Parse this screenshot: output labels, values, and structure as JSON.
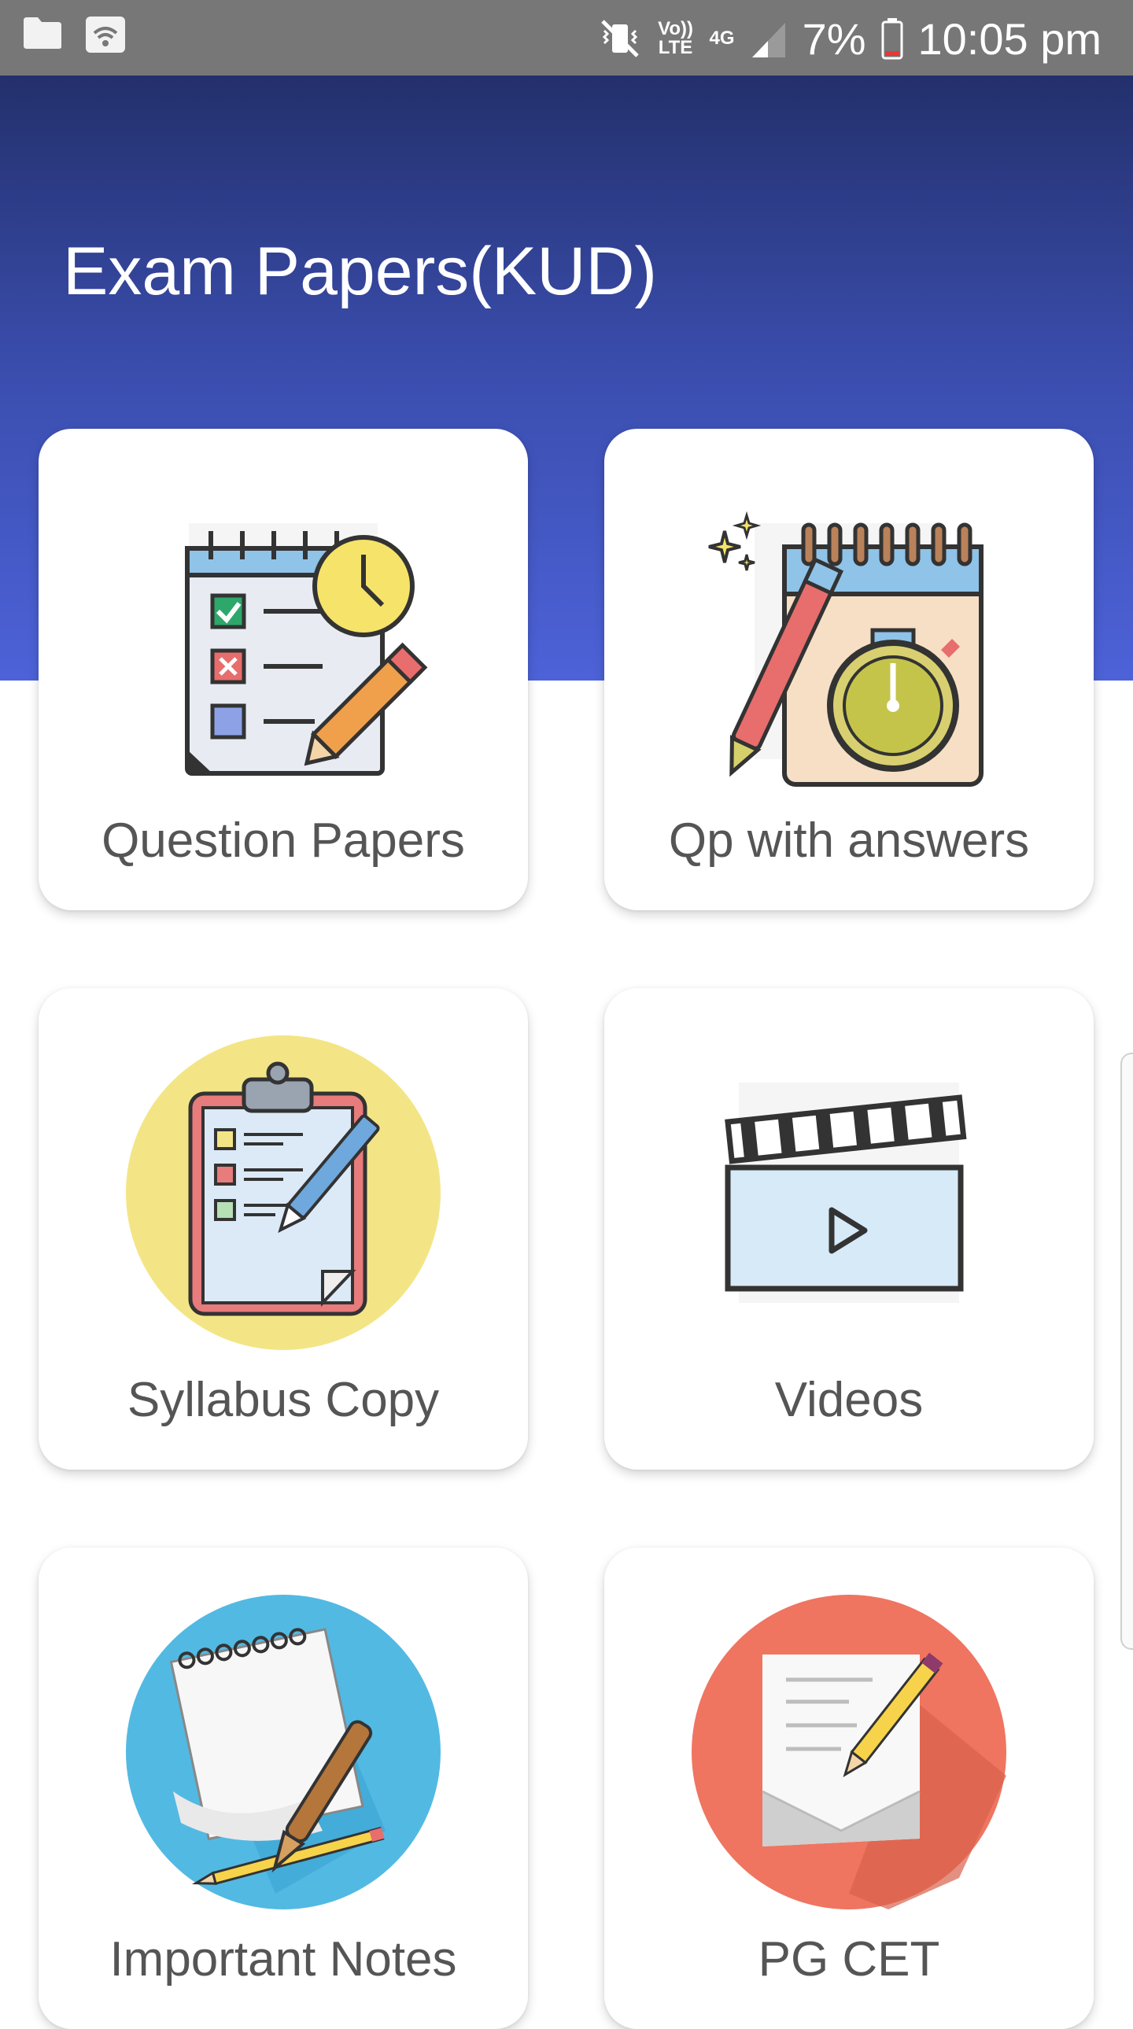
{
  "status_bar": {
    "volte_label": "Vo)) LTE",
    "network_label": "4G",
    "battery_percent": "7%",
    "time": "10:05 pm"
  },
  "header": {
    "title": "Exam Papers(KUD)",
    "gradient_colors": [
      "#23306c",
      "#4d62d8"
    ]
  },
  "cards": [
    {
      "label": "Question Papers",
      "icon": "checklist-clock-icon"
    },
    {
      "label": "Qp with answers",
      "icon": "notepad-stopwatch-icon"
    },
    {
      "label": "Syllabus Copy",
      "icon": "clipboard-icon"
    },
    {
      "label": "Videos",
      "icon": "clapperboard-icon"
    },
    {
      "label": "Important Notes",
      "icon": "notepad-pen-icon"
    },
    {
      "label": "PG CET",
      "icon": "document-pencil-icon"
    }
  ]
}
